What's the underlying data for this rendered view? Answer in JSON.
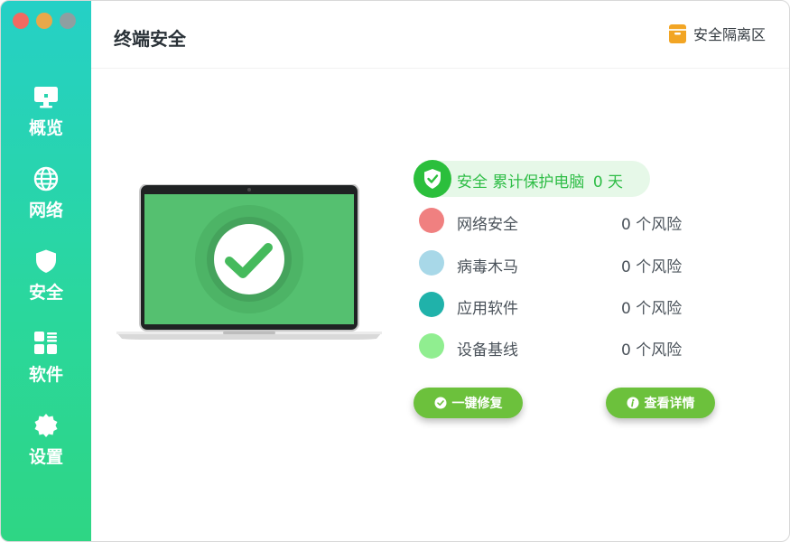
{
  "window": {
    "controls": [
      "close",
      "minimize",
      "maximize"
    ]
  },
  "sidebar": {
    "items": [
      {
        "label": "概览",
        "icon": "monitor-icon"
      },
      {
        "label": "网络",
        "icon": "globe-icon"
      },
      {
        "label": "安全",
        "icon": "shield-icon"
      },
      {
        "label": "软件",
        "icon": "apps-icon"
      },
      {
        "label": "设置",
        "icon": "gear-icon"
      }
    ]
  },
  "header": {
    "title": "终端安全",
    "quarantine_label": "安全隔离区"
  },
  "status": {
    "state": "安全",
    "protect_text": "累计保护电脑",
    "days": "0 天"
  },
  "risks": [
    {
      "label": "网络安全",
      "count": "0 个风险",
      "color": "#f08080"
    },
    {
      "label": "病毒木马",
      "count": "0 个风险",
      "color": "#a8d8e8"
    },
    {
      "label": "应用软件",
      "count": "0 个风险",
      "color": "#20b2aa"
    },
    {
      "label": "设备基线",
      "count": "0 个风险",
      "color": "#90ee90"
    }
  ],
  "actions": {
    "fix_label": "一键修复",
    "details_label": "查看详情"
  },
  "colors": {
    "accent": "#2ad79e",
    "success": "#2bbf3c",
    "button": "#6cc13c"
  }
}
